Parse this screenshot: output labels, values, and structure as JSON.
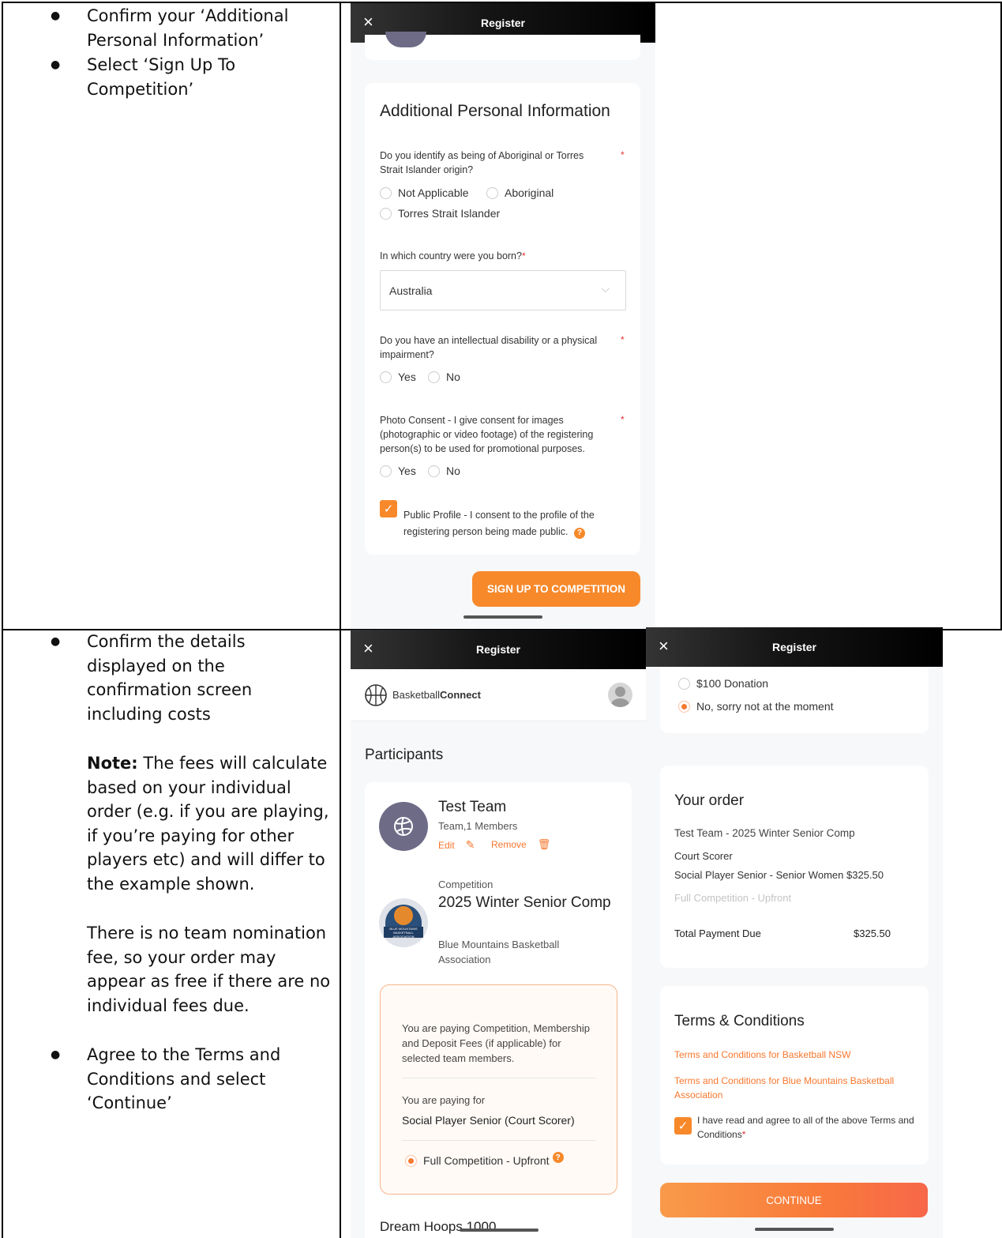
{
  "instructions": {
    "row1": {
      "bullets": [
        "Confirm your ‘Additional Personal Information’",
        "Select ‘Sign Up To Competition’"
      ]
    },
    "row2": {
      "bullet1": "Confirm the details displayed on the confirmation screen including costs",
      "note_label": "Note:",
      "note_text": " The fees will calculate based on your individual order (e.g. if you are playing, if you’re paying for other players etc) and will differ to the example shown.",
      "para2": "There is no team nomination fee, so your order may appear as free if there are no individual fees due.",
      "bullet2": "Agree to the Terms and Conditions and select ‘Continue’"
    }
  },
  "screen1": {
    "title": "Register",
    "close_icon": "×",
    "section_title": "Additional Personal Information",
    "q1": {
      "label": "Do you identify as being of Aboriginal or Torres Strait Islander origin?",
      "required": "*",
      "options": [
        "Not Applicable",
        "Aboriginal",
        "Torres Strait Islander"
      ]
    },
    "q2": {
      "label": "In which country were you born?",
      "required": "*",
      "value": "Australia",
      "chevron": "⌵"
    },
    "q3": {
      "label": "Do you have an intellectual disability or a physical impairment?",
      "required": "*",
      "options": [
        "Yes",
        "No"
      ]
    },
    "q4": {
      "label": "Photo Consent - I give consent for images (photographic or video footage) of the registering person(s) to be used for promotional purposes.",
      "required": "*",
      "options": [
        "Yes",
        "No"
      ]
    },
    "public_profile": {
      "label": "Public Profile - I consent to the profile of the registering person being made public.",
      "checked": true,
      "help": "?"
    },
    "submit_label": "SIGN UP TO COMPETITION"
  },
  "screen2": {
    "title": "Register",
    "close_icon": "×",
    "brand_plain": "Basketball",
    "brand_bold": "Connect",
    "section_title": "Participants",
    "team_name": "Test Team",
    "team_members": "Team,1 Members",
    "edit_label": "Edit",
    "remove_label": "Remove",
    "competition_label": "Competition",
    "competition_name": "2025 Winter Senior Comp",
    "association": "Blue Mountains Basketball Association",
    "paying_text": "You are paying Competition, Membership and Deposit Fees (if applicable) for selected team members.",
    "paying_for_label": "You are paying for",
    "paying_for_value": "Social Player Senior (Court Scorer)",
    "fee_option": "Full Competition - Upfront",
    "help": "?",
    "next_team": "Dream Hoops 1000",
    "logo_text": "BLUE MOUNTAINS BASKETBALL ASSOCIATION"
  },
  "screen3": {
    "title": "Register",
    "close_icon": "×",
    "donation_options": [
      "$100 Donation",
      "No, sorry not at the moment"
    ],
    "order_title": "Your order",
    "order_line": "Test Team - 2025 Winter Senior Comp",
    "order_role": "Court Scorer",
    "order_item": "Social Player Senior - Senior Women",
    "order_item_price": "$325.50",
    "order_fee_type": "Full Competition - Upfront",
    "total_label": "Total Payment Due",
    "total_value": "$325.50",
    "terms_title": "Terms & Conditions",
    "terms_link1": "Terms and Conditions for Basketball NSW",
    "terms_link2": "Terms and Conditions for Blue Mountains Basketball Association",
    "agree_text": "I have read and agree to all of the above Terms and Conditions",
    "agree_required": "*",
    "continue_label": "CONTINUE"
  },
  "colors": {
    "accent": "#f7772d",
    "topbar": "#000000",
    "background": "#f7f8fa"
  }
}
